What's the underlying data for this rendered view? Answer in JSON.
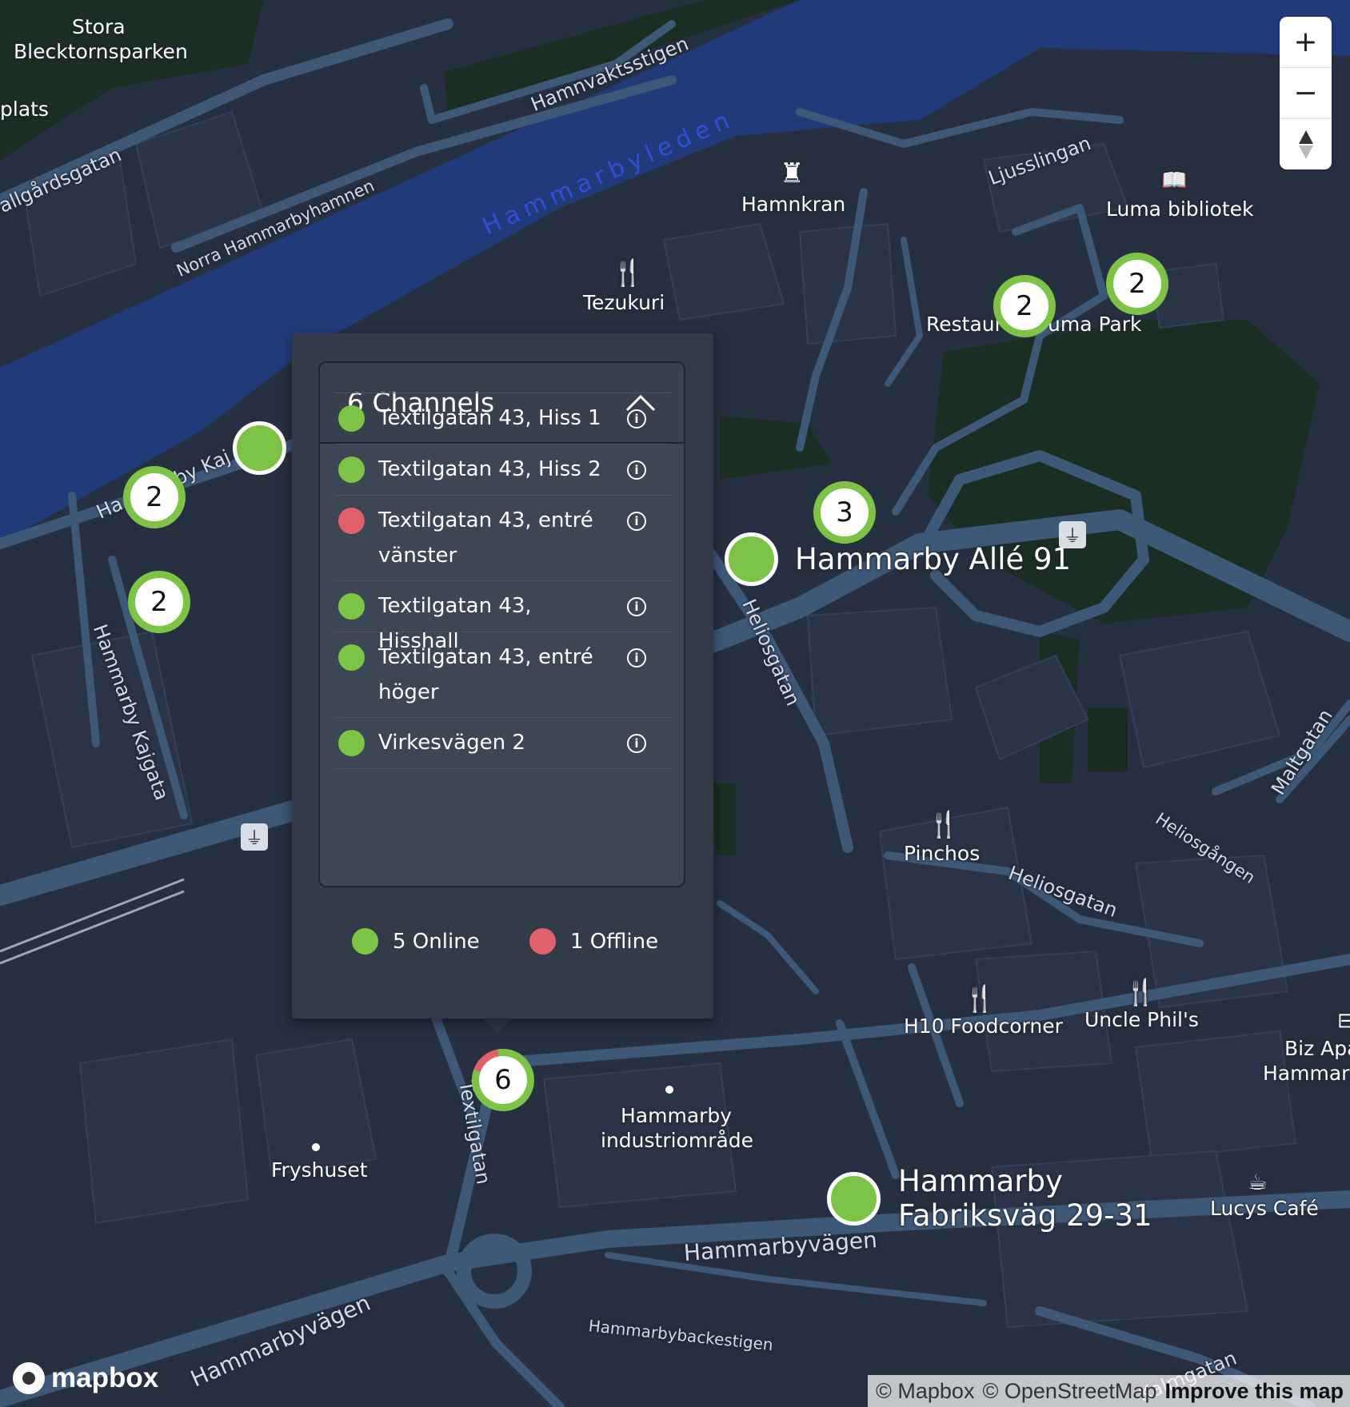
{
  "map": {
    "colors": {
      "land": "#273041",
      "water": "#213b7a",
      "road": "#3e5878",
      "park": "#1c2e23",
      "building": "#2b3446"
    },
    "water_label": "Hammarbyleden",
    "places": {
      "stora": "Stora",
      "blecktornsparken": "Blecktornsparken",
      "plats_partial": "plats",
      "hamnkran": "Hamnkran",
      "luma_bibliotek": "Luma bibliotek",
      "tezukuri": "Tezukuri",
      "restaurant_partial_left": "Restaura",
      "luma_park_partial": "uma Park",
      "hammarby_alle": "Hammarby Allé 91",
      "pinchos": "Pinchos",
      "h10": "H10 Foodcorner",
      "uncle_phil": "Uncle Phil's",
      "biz_1": "Biz Apa",
      "biz_2": "Hammarb",
      "hammarby_ind_1": "Hammarby",
      "hammarby_ind_2": "industriområde",
      "fryshuset": "Fryshuset",
      "fabriksvag_1": "Hammarby",
      "fabriksvag_2": "Fabriksväg 29-31",
      "lucys": "Lucys Café"
    },
    "streets": {
      "hamnvaktsstigen": "Hamnvaktsstigen",
      "allgardsgatan": "allgårdsgatan",
      "norra": "Norra Hammarbyhamnen",
      "ljusslingan": "Ljusslingan",
      "kaj_left": "Ha",
      "kaj_right": "rby Kaj",
      "kajgata": "Hammarby Kajgata",
      "heliosgatan_1": "Heliosgatan",
      "heliosgatan_2": "Heliosgatan",
      "heliosgangen": "Heliosgången",
      "maltgatan": "Maltgatan",
      "textilgatan": "Textilgatan",
      "hammarbyvagen_1": "Hammarbyvägen",
      "hammarbyvagen_2": "Hammarbyvägen",
      "backestigen": "Hammarbybackestigen",
      "kalmgatan": "Kalmgatan"
    },
    "clusters": {
      "c1": "2",
      "c2": "2",
      "c3": "2",
      "c4": "2",
      "c5": "3",
      "c6": "6"
    },
    "cluster_offline_fraction": 0.167,
    "zoom_controls": {
      "zoom_in": "+",
      "zoom_out": "−"
    }
  },
  "popup": {
    "title": "6 Channels",
    "channels": [
      {
        "name": "Textilgatan 43, Hiss 1",
        "status": "online"
      },
      {
        "name": "Textilgatan 43, Hiss 2",
        "status": "online"
      },
      {
        "name": "Textilgatan 43, entré vänster",
        "status": "offline"
      },
      {
        "name": "Textilgatan 43, Hisshall",
        "status": "online"
      },
      {
        "name": "Textilgatan 43, entré höger",
        "status": "online"
      },
      {
        "name": "Virkesvägen 2",
        "status": "online"
      }
    ],
    "online_label": "5 Online",
    "offline_label": "1 Offline",
    "status_colors": {
      "online": "#7dc346",
      "offline": "#e0616b"
    }
  },
  "attribution": {
    "mapbox": "© Mapbox",
    "osm": "© OpenStreetMap",
    "improve": "Improve this map"
  },
  "logo": {
    "text": "mapbox"
  }
}
